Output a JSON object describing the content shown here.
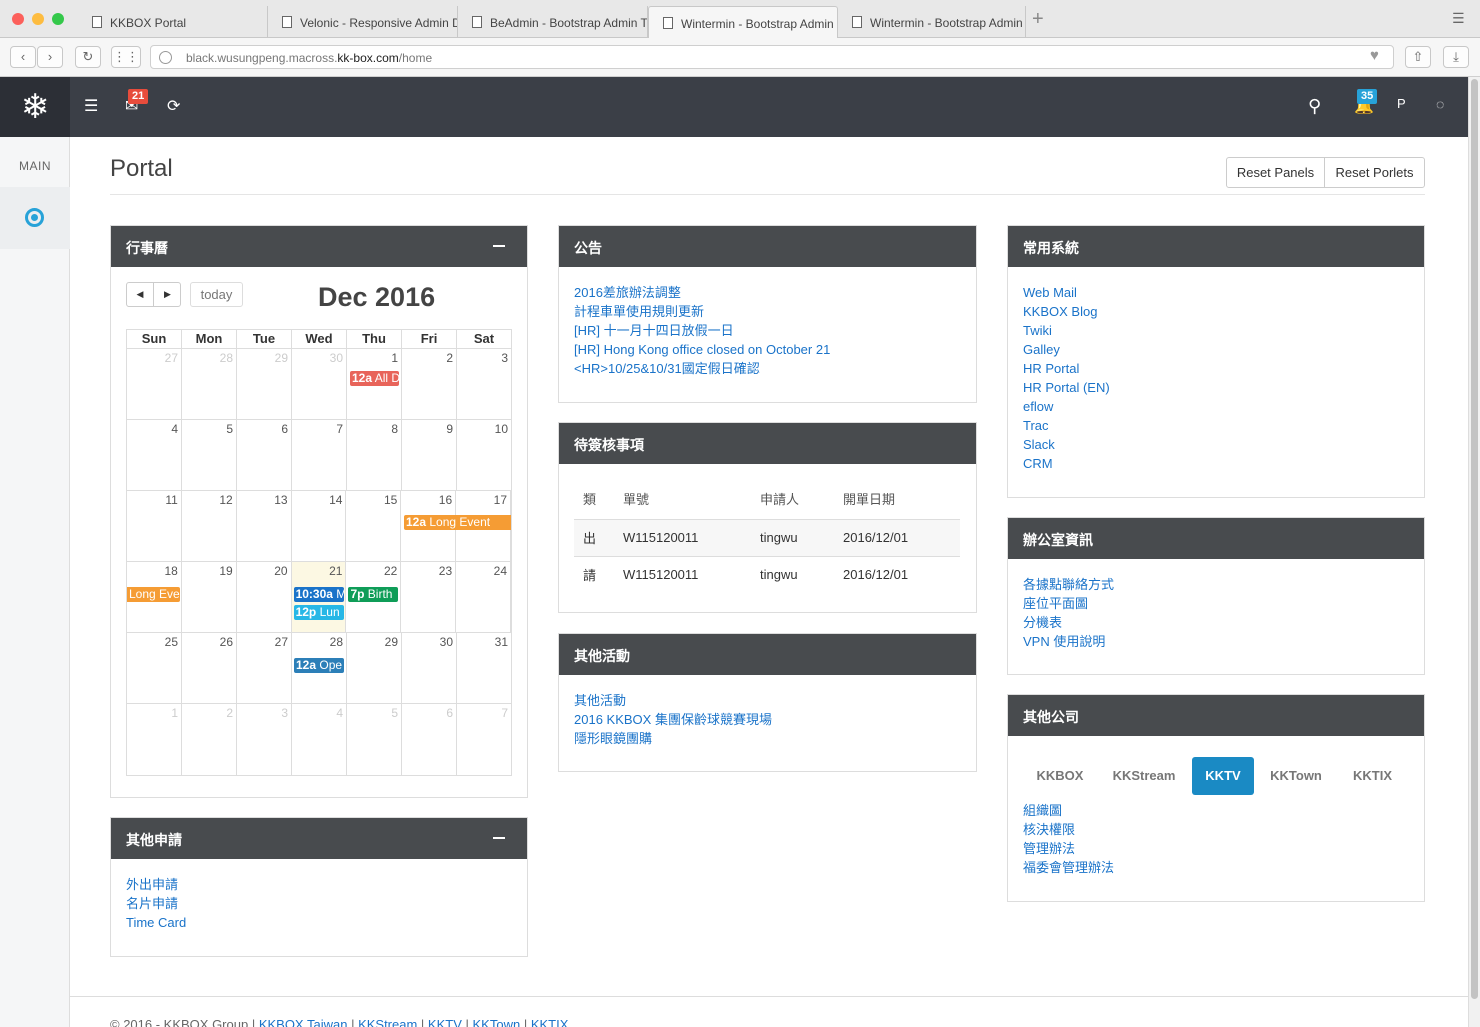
{
  "browser": {
    "tabs": [
      "KKBOX Portal",
      "Velonic - Responsive Admin D",
      "BeAdmin - Bootstrap Admin T",
      "Wintermin - Bootstrap Admin",
      "Wintermin - Bootstrap Admin"
    ],
    "url_prefix": "black.wusungpeng.macross.",
    "url_host": "kk-box.com",
    "url_path": "/home"
  },
  "header": {
    "mail_badge": "21",
    "bell_badge": "35"
  },
  "sidebar": {
    "section_label": "MAIN"
  },
  "page": {
    "title": "Portal",
    "reset_panels": "Reset Panels",
    "reset_porlets": "Reset Porlets"
  },
  "calendar": {
    "panel_title": "行事曆",
    "today_label": "today",
    "month_title": "Dec 2016",
    "weekdays": [
      "Sun",
      "Mon",
      "Tue",
      "Wed",
      "Thu",
      "Fri",
      "Sat"
    ],
    "weeks": [
      [
        "27",
        "28",
        "29",
        "30",
        "1",
        "2",
        "3"
      ],
      [
        "4",
        "5",
        "6",
        "7",
        "8",
        "9",
        "10"
      ],
      [
        "11",
        "12",
        "13",
        "14",
        "15",
        "16",
        "17"
      ],
      [
        "18",
        "19",
        "20",
        "21",
        "22",
        "23",
        "24"
      ],
      [
        "25",
        "26",
        "27",
        "28",
        "29",
        "30",
        "31"
      ],
      [
        "1",
        "2",
        "3",
        "4",
        "5",
        "6",
        "7"
      ]
    ],
    "events": [
      {
        "time": "12a",
        "title": "All D"
      },
      {
        "time": "12a",
        "title": "Long Event"
      },
      {
        "time": "",
        "title": "Long Eve"
      },
      {
        "time": "10:30a",
        "title": "M"
      },
      {
        "time": "12p",
        "title": "Lun"
      },
      {
        "time": "7p",
        "title": "Birth"
      },
      {
        "time": "12a",
        "title": "Ope"
      }
    ]
  },
  "other_apply": {
    "panel_title": "其他申請",
    "links": [
      "外出申請",
      "名片申請",
      "Time Card"
    ]
  },
  "announce": {
    "panel_title": "公告",
    "links": [
      "2016差旅辦法調整",
      "計程車單使用規則更新",
      "[HR] 十一月十四日放假一日",
      "[HR] Hong Kong office closed on October 21",
      "<HR>10/25&10/31國定假日確認"
    ]
  },
  "pending": {
    "panel_title": "待簽核事項",
    "columns": [
      "類",
      "單號",
      "申請人",
      "開單日期"
    ],
    "rows": [
      [
        "出",
        "W115120011",
        "tingwu",
        "2016/12/01"
      ],
      [
        "請",
        "W115120011",
        "tingwu",
        "2016/12/01"
      ]
    ]
  },
  "activities": {
    "panel_title": "其他活動",
    "links": [
      "其他活動",
      "2016 KKBOX 集團保齡球競賽現場",
      "隱形眼鏡團購"
    ]
  },
  "systems": {
    "panel_title": "常用系統",
    "links": [
      "Web Mail",
      "KKBOX Blog",
      "Twiki",
      "Galley",
      "HR Portal",
      "HR Portal (EN)",
      "eflow",
      "Trac",
      "Slack",
      "CRM"
    ]
  },
  "office": {
    "panel_title": "辦公室資訊",
    "links": [
      "各據點聯絡方式",
      "座位平面圖",
      "分機表",
      "VPN 使用說明"
    ]
  },
  "companies": {
    "panel_title": "其他公司",
    "tabs": [
      "KKBOX",
      "KKStream",
      "KKTV",
      "KKTown",
      "KKTIX"
    ],
    "links": [
      "組織圖",
      "核決權限",
      "管理辦法",
      "福委會管理辦法"
    ]
  },
  "footer": {
    "copyright": "© 2016 - KKBOX Group",
    "links": [
      "KKBOX Taiwan",
      "KKStream",
      "KKTV",
      "KKTown",
      "KKTIX"
    ]
  }
}
